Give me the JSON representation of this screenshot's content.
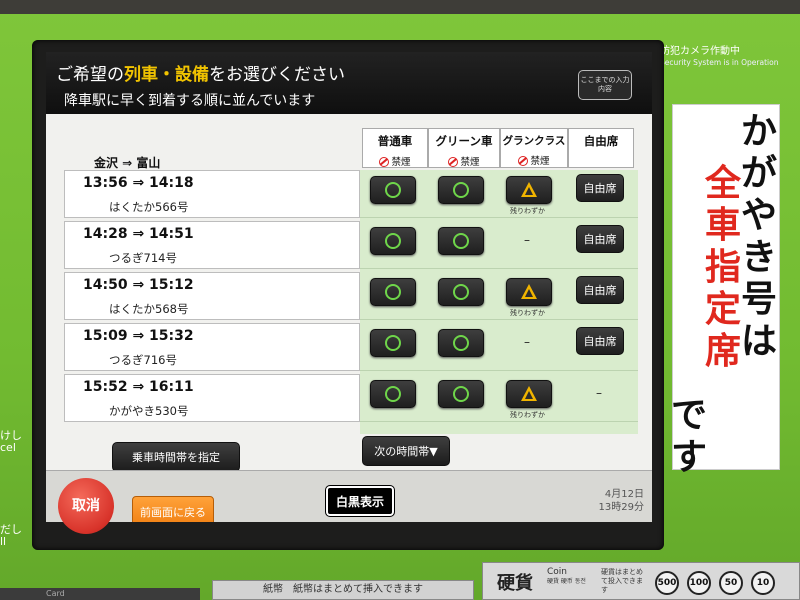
{
  "header": {
    "line1_prefix": "ご希望の",
    "line1_hl1": "列車",
    "line1_dot": "・",
    "line1_hl2": "設備",
    "line1_suffix": "をお選びください",
    "line2": "降車駅に早く到着する順に並んでいます",
    "input_button": "ここまでの入力内容"
  },
  "route": "金沢 ⇒ 富山",
  "columns": [
    {
      "label": "普通車",
      "sub": "禁煙"
    },
    {
      "label": "グリーン車",
      "sub": "禁煙"
    },
    {
      "label": "グランクラス",
      "sub": "禁煙"
    },
    {
      "label": "自由席",
      "sub": ""
    }
  ],
  "trains": [
    {
      "time": "13:56 ⇒ 14:18",
      "name": "はくたか566号",
      "ordinary": "circle",
      "green": "circle",
      "gran": "triangle",
      "gran_note": "残りわずか",
      "free": "自由席"
    },
    {
      "time": "14:28 ⇒ 14:51",
      "name": "つるぎ714号",
      "ordinary": "circle",
      "green": "circle",
      "gran": "none",
      "gran_note": "",
      "free": "自由席"
    },
    {
      "time": "14:50 ⇒ 15:12",
      "name": "はくたか568号",
      "ordinary": "circle",
      "green": "circle",
      "gran": "triangle",
      "gran_note": "残りわずか",
      "free": "自由席"
    },
    {
      "time": "15:09 ⇒ 15:32",
      "name": "つるぎ716号",
      "ordinary": "circle",
      "green": "circle",
      "gran": "none",
      "gran_note": "",
      "free": "自由席"
    },
    {
      "time": "15:52 ⇒ 16:11",
      "name": "かがやき530号",
      "ordinary": "circle",
      "green": "circle",
      "gran": "triangle",
      "gran_note": "残りわずか",
      "free": "–"
    }
  ],
  "dash": "–",
  "controls": {
    "set_time": "乗車時間帯を指定",
    "next_time": "次の時間帯▼",
    "cancel": "取消",
    "back": "前画面に戻る",
    "mono": "白黒表示",
    "date": "4月12日",
    "time": "13時29分"
  },
  "side": {
    "left_top": "けし",
    "left_top_en": "cel",
    "left_bottom": "だし",
    "left_bottom_en": "ll",
    "security_jp": "防犯カメラ作動中",
    "security_en": "Security System is in Operation"
  },
  "sign": {
    "col_right": "かがやき号は",
    "col_mid": "全車指定席",
    "col_left": "です"
  },
  "coin_panel": {
    "label": "硬貨",
    "en": "Coin",
    "sub": "硬貨 硬币 동전",
    "note": "硬貨はまとめて投入できます",
    "coins": [
      "500",
      "100",
      "50",
      "10"
    ]
  },
  "bill_panel": "紙幣　紙幣はまとめて挿入できます",
  "card_panel": "Card",
  "colors": {
    "accent_yellow": "#f2c400",
    "circle_green": "#6fd64a",
    "triangle_amber": "#f0b400",
    "sign_red": "#e0281e",
    "kiosk_green": "#7fc63a"
  }
}
